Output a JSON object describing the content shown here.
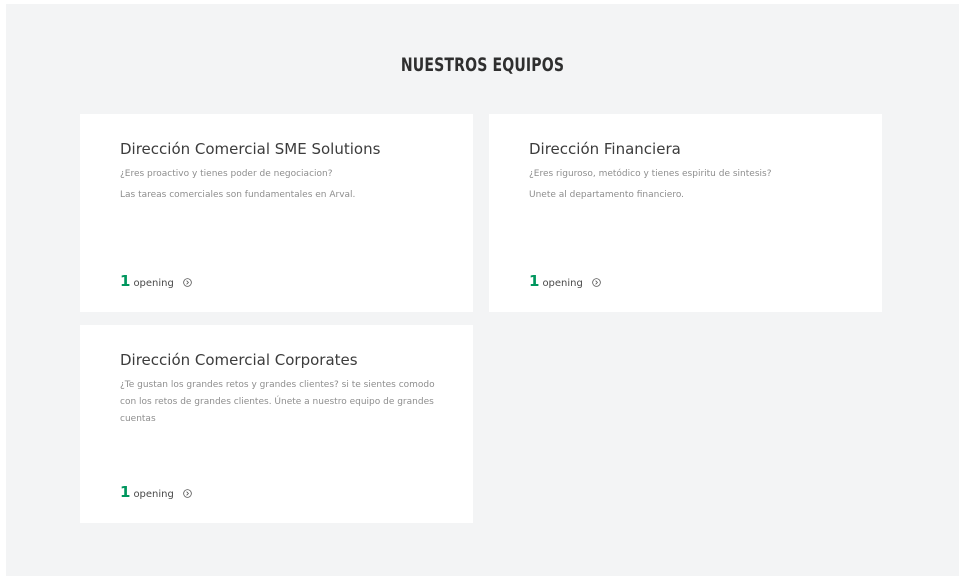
{
  "section": {
    "title": "NUESTROS EQUIPOS"
  },
  "teams": [
    {
      "title": "Dirección Comercial SME Solutions",
      "lines": [
        "¿Eres proactivo y tienes poder de negociacion?",
        "Las tareas comerciales son fundamentales en Arval."
      ],
      "opening_count": "1",
      "opening_label": "opening"
    },
    {
      "title": "Dirección Financiera",
      "lines": [
        "¿Eres riguroso, metódico y tienes espiritu de sintesis?",
        "Unete al departamento financiero."
      ],
      "opening_count": "1",
      "opening_label": "opening"
    },
    {
      "title": "Dirección Comercial Corporates",
      "lines": [
        "¿Te gustan los grandes retos y grandes clientes? si te sientes comodo con los retos de grandes clientes. Únete a nuestro equipo de grandes cuentas"
      ],
      "opening_count": "1",
      "opening_label": "opening"
    }
  ],
  "icons": {
    "opening_arrow": "circle-chevron-right-icon"
  },
  "colors": {
    "background": "#f3f4f5",
    "card": "#ffffff",
    "accent": "#00965e"
  }
}
